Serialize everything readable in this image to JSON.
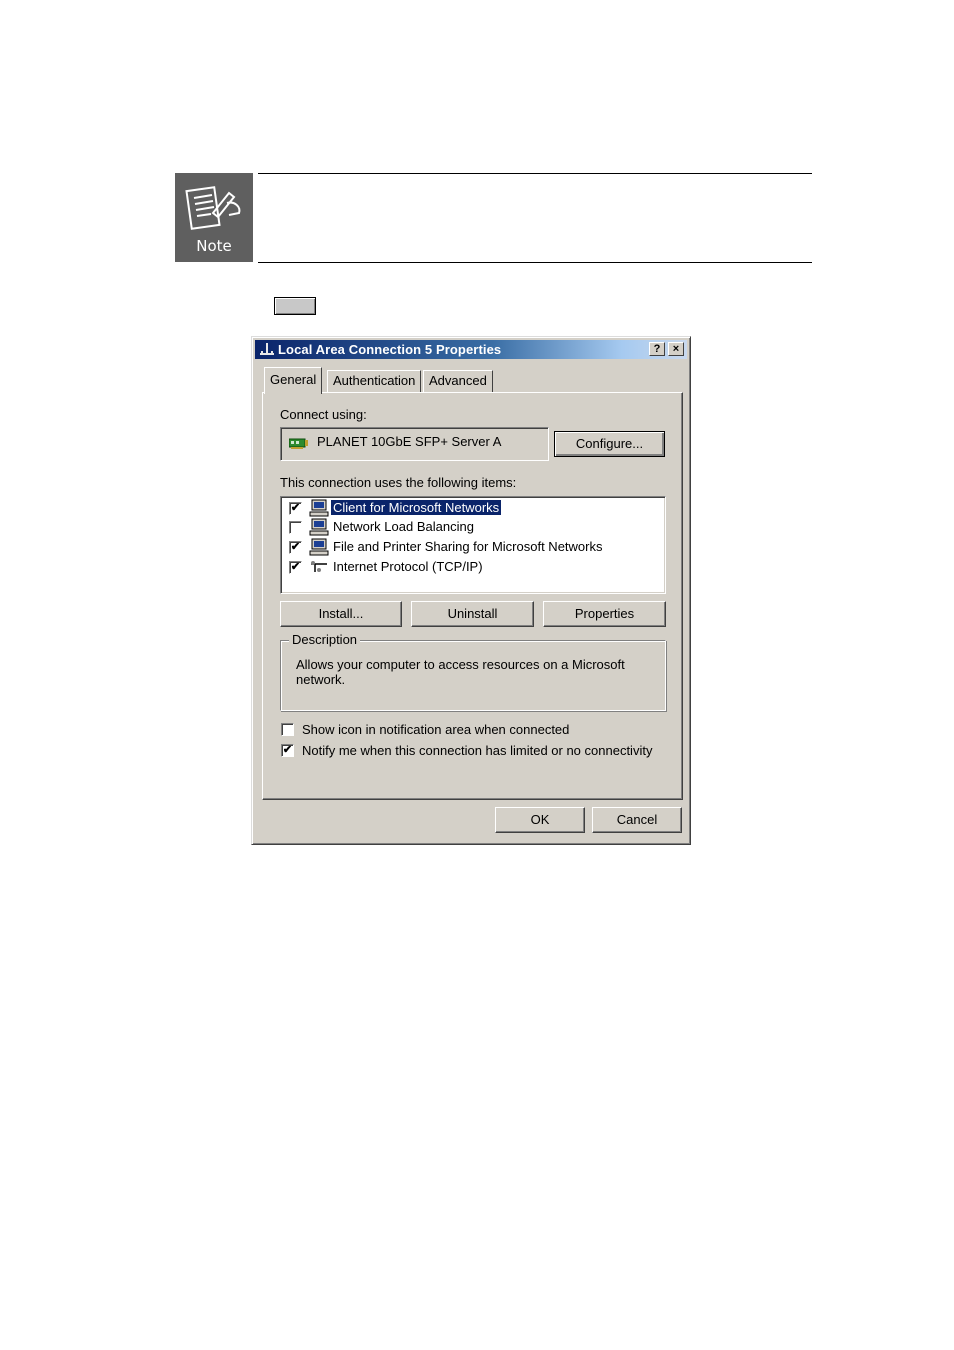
{
  "note": {
    "label": "Note"
  },
  "dialog": {
    "title": "Local Area Connection 5 Properties",
    "help_glyph": "?",
    "close_glyph": "×",
    "tabs": [
      {
        "label": "General",
        "active": true
      },
      {
        "label": "Authentication",
        "active": false
      },
      {
        "label": "Advanced",
        "active": false
      }
    ],
    "connect_using_label": "Connect using:",
    "adapter_name": "PLANET 10GbE SFP+ Server A",
    "configure_button": "Configure...",
    "items_label": "This connection uses the following items:",
    "items": [
      {
        "label": "Client for Microsoft Networks",
        "checked": true,
        "selected": true,
        "icon": "network-client-icon"
      },
      {
        "label": "Network Load Balancing",
        "checked": false,
        "selected": false,
        "icon": "network-client-icon"
      },
      {
        "label": "File and Printer Sharing for Microsoft Networks",
        "checked": true,
        "selected": false,
        "icon": "network-service-icon"
      },
      {
        "label": "Internet Protocol (TCP/IP)",
        "checked": true,
        "selected": false,
        "icon": "protocol-icon"
      }
    ],
    "install_button": "Install...",
    "uninstall_button": "Uninstall",
    "properties_button": "Properties",
    "description_title": "Description",
    "description_text": "Allows your computer to access resources on a Microsoft network.",
    "show_icon_label": "Show icon in notification area when connected",
    "show_icon_checked": false,
    "notify_label": "Notify me when this connection has limited or no connectivity",
    "notify_checked": true,
    "ok_button": "OK",
    "cancel_button": "Cancel",
    "colors": {
      "face": "#d4d0c8",
      "title_start": "#0a246a",
      "title_end": "#a6caf0",
      "selection": "#0a246a"
    }
  }
}
